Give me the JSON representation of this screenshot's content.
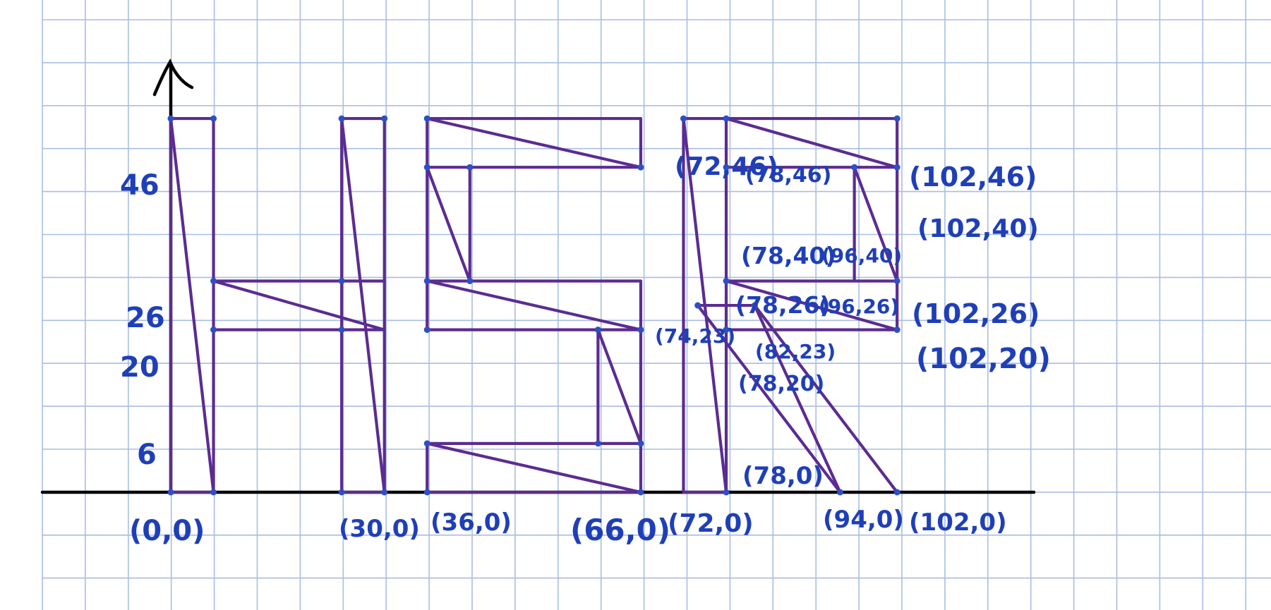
{
  "colors": {
    "grid": "#a9bde3",
    "axis": "#000000",
    "shape": "#5b2c91",
    "label": "#1f3fb8",
    "vertex": "#2f4fc4",
    "background": "#ffffff"
  },
  "y_axis_labels": [
    "46",
    "26",
    "20",
    "6"
  ],
  "x_axis_labels": [
    "(0,0)",
    "(30,0)",
    "(36,0)",
    "(66,0)",
    "(72,0)",
    "(94,0)",
    "(102,0)"
  ],
  "point_labels": [
    "(72,46)",
    "(78,46)",
    "(102,46)",
    "(102,40)",
    "(78,40)",
    "(96,40)",
    "(78,26)",
    "(96,26)",
    "(102,26)",
    "(74,23)",
    "(82,23)",
    "(102,20)",
    "(78,20)",
    "(78,0)"
  ]
}
